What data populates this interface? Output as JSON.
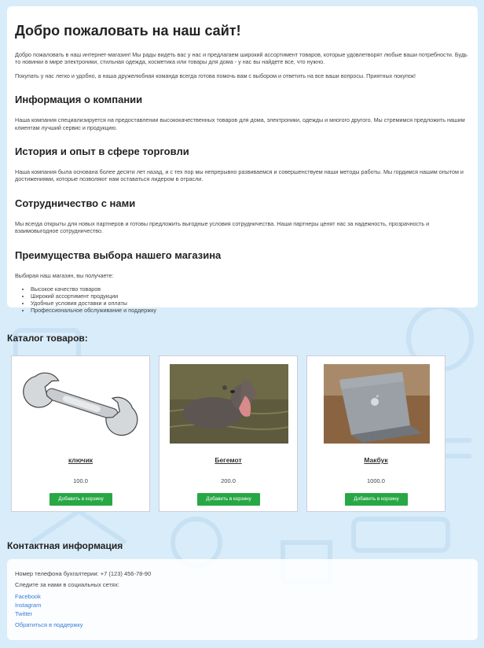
{
  "intro": {
    "title": "Добро пожаловать на наш сайт!",
    "p1": "Добро пожаловать в наш интернет-магазин! Мы рады видеть вас у нас и предлагаем широкий ассортимент товаров, которые удовлетворят любые ваши потребности. Будь то новинки в мире электроники, стильная одежда, косметика или товары для дома - у нас вы найдете все, что нужно.",
    "p2": "Покупать у нас легко и удобно, а наша дружелюбная команда всегда готова помочь вам с выбором и ответить на все ваши вопросы. Приятных покупок!",
    "sections": [
      {
        "heading": "Информация о компании",
        "text": "Наша компания специализируется на предоставлении высококачественных товаров для дома, электроники, одежды и многого другого. Мы стремимся предложить нашим клиентам лучший сервис и продукцию."
      },
      {
        "heading": "История и опыт в сфере торговли",
        "text": "Наша компания была основана более десяти лет назад, и с тех пор мы непрерывно развиваемся и совершенствуем наши методы работы. Мы гордимся нашим опытом и достижениями, которые позволяют нам оставаться лидером в отрасли."
      },
      {
        "heading": "Сотрудничество с нами",
        "text": "Мы всегда открыты для новых партнеров и готовы предложить выгодные условия сотрудничества. Наши партнеры ценят нас за надежность, прозрачность и взаимовыгодное сотрудничество."
      }
    ],
    "advantages": {
      "heading": "Преимущества выбора нашего магазина",
      "lead": "Выбирая наш магазин, вы получаете:",
      "items": [
        "Высокое качество товаров",
        "Широкий ассортимент продукции",
        "Удобные условия доставки и оплаты",
        "Профессиональное обслуживание и поддержку"
      ]
    }
  },
  "catalog": {
    "title": "Каталог товаров:",
    "add_label": "Добавить в корзину",
    "products": [
      {
        "name": "ключик",
        "price": "100.0",
        "image": "wrench-image"
      },
      {
        "name": "Бегемот",
        "price": "200.0",
        "image": "hippo-image"
      },
      {
        "name": "Макбук",
        "price": "1000.0",
        "image": "laptop-image"
      }
    ]
  },
  "contact": {
    "title": "Контактная информация",
    "phone": "Номер телефона бухгалтерии: +7 (123) 456-78-90",
    "social_lead": "Следите за нами в социальных сетях:",
    "links": [
      "Facebook",
      "Instagram",
      "Twitter"
    ],
    "support": "Обратиться в поддержку"
  },
  "colors": {
    "background": "#d9ecf9",
    "button": "#28a745",
    "link": "#3a7bd5"
  }
}
